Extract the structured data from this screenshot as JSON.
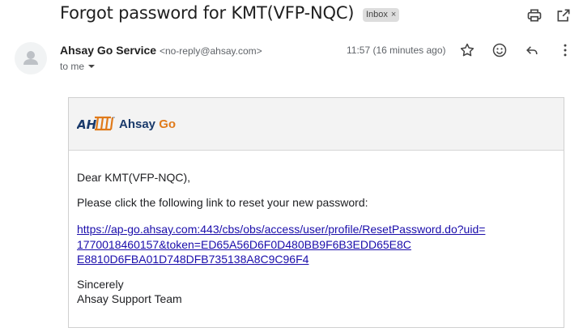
{
  "email": {
    "subject": "Forgot password for KMT(VFP-NQC)",
    "label_chip": "Inbox",
    "label_chip_close": "×",
    "sender_name": "Ahsay Go Service",
    "sender_address": "<no-reply@ahsay.com>",
    "recipient_label": "to me",
    "time": "11:57 (16 minutes ago)"
  },
  "icons": {
    "print": "print-icon",
    "open_new_window": "open-in-new-window-icon",
    "star": "star-icon",
    "emoji": "emoji-icon",
    "reply": "reply-icon",
    "more": "more-vert-icon"
  },
  "body": {
    "logo_mark": "AH",
    "logo_tm": "™",
    "logo_brand": "Ahsay",
    "logo_go": "Go",
    "greeting": "Dear KMT(VFP-NQC),",
    "instruction": "Please click the following link to reset your new password:",
    "link_line1": "https://ap-go.ahsay.com:443/cbs/obs/access/user/profile/ResetPassword.do?uid=",
    "link_line2": "1770018460157&token=ED65A56D6F0D480BB9F6B3EDD65E8C",
    "link_line3": "E8810D6FBA01D748DFB735138A8C9C96F4",
    "signoff": "Sincerely",
    "signature": "Ahsay Support Team"
  },
  "colors": {
    "link": "#1a0dab",
    "logo_blue": "#1a3a6b",
    "logo_orange": "#e07a1a",
    "chip_bg": "#dddddd"
  }
}
